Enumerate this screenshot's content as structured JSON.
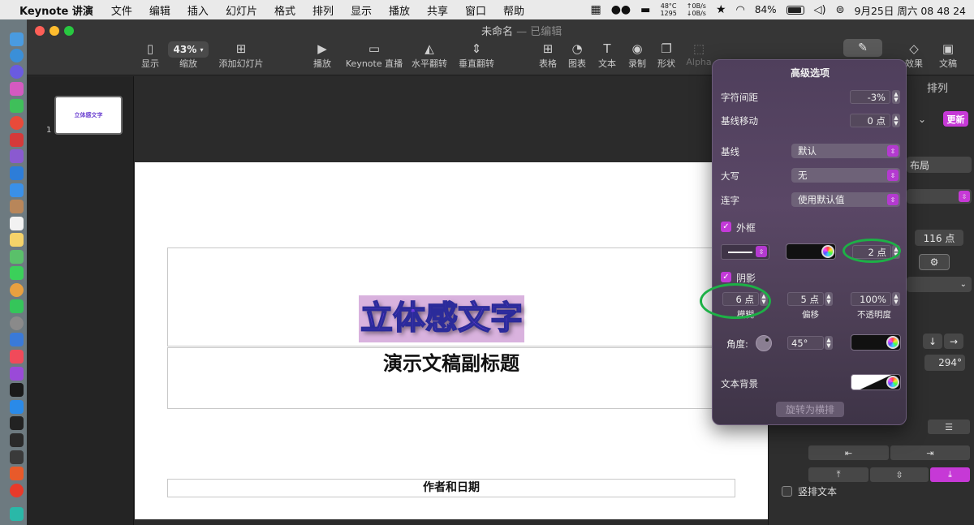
{
  "menubar": {
    "app_name": "Keynote 讲演",
    "items": [
      "文件",
      "编辑",
      "插入",
      "幻灯片",
      "格式",
      "排列",
      "显示",
      "播放",
      "共享",
      "窗口",
      "帮助"
    ],
    "cpu_temp": "48°C",
    "fan": "1295",
    "net_up": "↑0B/s",
    "net_down": "↓0B/s",
    "battery": "84%",
    "datetime": "9月25日 周六  08 48 24"
  },
  "window": {
    "title": "未命名",
    "edited": "— 已编辑"
  },
  "toolbar": {
    "view": "显示",
    "zoom_value": "43%",
    "zoom": "缩放",
    "add_slide": "添加幻灯片",
    "play": "播放",
    "keynote_live": "Keynote 直播",
    "flip_h": "水平翻转",
    "flip_v": "垂直翻转",
    "table": "表格",
    "chart": "图表",
    "text": "文本",
    "record": "录制",
    "shape": "形状",
    "alpha": "Alpha",
    "effects": "效果",
    "document": "文稿"
  },
  "navigator": {
    "thumb_title": "立体感文字",
    "slide_number": "1"
  },
  "slide": {
    "title": "立体感文字",
    "subtitle": "演示文稿副标题",
    "author": "作者和日期"
  },
  "inspector": {
    "tab_arrange": "排列",
    "update": "更新",
    "layout": "布局",
    "size": "116 点",
    "angle": "294°",
    "vertical_text": "竖排文本"
  },
  "popover": {
    "title": "高级选项",
    "char_spacing_label": "字符间距",
    "char_spacing": "-3%",
    "baseline_shift_label": "基线移动",
    "baseline_shift": "0 点",
    "baseline_label": "基线",
    "baseline": "默认",
    "caps_label": "大写",
    "caps": "无",
    "ligature_label": "连字",
    "ligature": "使用默认值",
    "outline_label": "外框",
    "outline_width": "2 点",
    "shadow_label": "阴影",
    "blur": "6 点",
    "blur_label": "模糊",
    "offset": "5 点",
    "offset_label": "偏移",
    "opacity": "100%",
    "opacity_label": "不透明度",
    "angle_label": "角度:",
    "angle": "45°",
    "text_bg_label": "文本背景",
    "rotate_button": "旋转为横排"
  },
  "colors": {
    "accent": "#c639d6",
    "highlight": "#1db046",
    "title_fill": "#6b3cdf"
  }
}
